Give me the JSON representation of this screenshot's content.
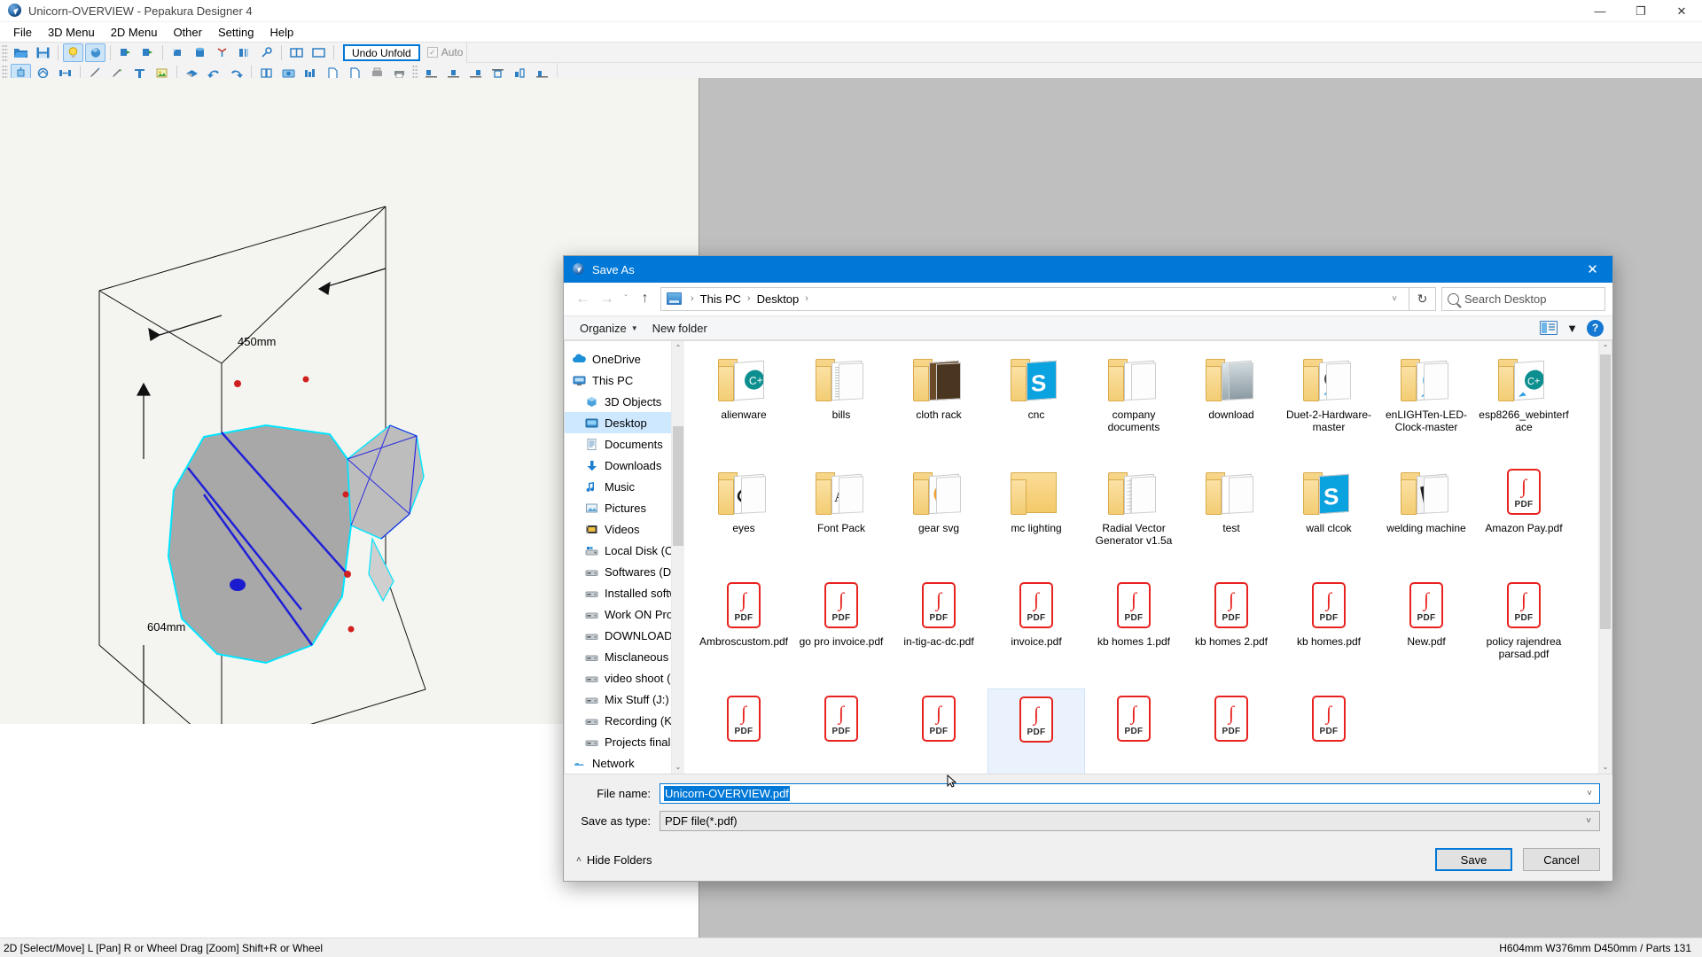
{
  "app": {
    "title": "Unicorn-OVERVIEW - Pepakura Designer 4",
    "icon": "pepakura-globe-icon",
    "window_controls": {
      "minimize": "—",
      "maximize": "❐",
      "close": "✕"
    },
    "menus": [
      "File",
      "3D Menu",
      "2D Menu",
      "Other",
      "Setting",
      "Help"
    ],
    "toolbar1": {
      "undo_label": "Undo Unfold",
      "auto_label": "Auto",
      "auto_checked": true,
      "icons": [
        "open-folder-icon",
        "save-disk-icon",
        "lightbulb-icon",
        "texture-sphere-icon",
        "unfold-arrow-icon",
        "refold-arrow-icon",
        "paint-icon",
        "cylinder-icon",
        "axis-icon",
        "mirror-icon",
        "join-icon",
        "split-view-icon",
        "single-view-icon"
      ]
    },
    "toolbar2": {
      "icons": [
        "select-move-icon",
        "shape-icon",
        "flip-icon",
        "pencil-icon",
        "green-pen-icon",
        "text-tool-icon",
        "image-tool-icon",
        "fold-icon",
        "undo-icon",
        "redo-icon",
        "open-part-icon",
        "camera-icon",
        "layout-icon",
        "page-icon",
        "page2-icon",
        "print-preview-icon",
        "print-icon",
        "align-left-icon",
        "align-center-icon",
        "align-right-icon",
        "align-top-icon",
        "align-middle-icon",
        "align-bottom-icon"
      ]
    },
    "status": {
      "left": "2D [Select/Move] L [Pan] R or Wheel Drag [Zoom] Shift+R or Wheel",
      "right": "H604mm W376mm D450mm / Parts 131"
    },
    "model": {
      "dim_height": "604mm",
      "dim_width": "376mm",
      "dim_depth": "450mm"
    }
  },
  "dialog": {
    "title": "Save As",
    "icon": "pepakura-globe-icon",
    "close": "✕",
    "nav": {
      "back": "←",
      "forward": "→",
      "recent": "ˇ",
      "up": "↑",
      "breadcrumbs": [
        "This PC",
        "Desktop"
      ],
      "breadcrumb_sep": "›",
      "dropdown": "˅",
      "refresh": "↻",
      "search_placeholder": "Search Desktop",
      "search_value": ""
    },
    "commands": {
      "organize": "Organize",
      "organize_caret": "▼",
      "new_folder": "New folder",
      "view_caret": "▼",
      "help": "?"
    },
    "tree": {
      "scroll_up": "⌃",
      "scroll_down": "⌄",
      "items": [
        {
          "label": "OneDrive",
          "icon": "onedrive-cloud-icon",
          "level": 0,
          "selected": false
        },
        {
          "label": "This PC",
          "icon": "this-pc-monitor-icon",
          "level": 0,
          "selected": false
        },
        {
          "label": "3D Objects",
          "icon": "3d-objects-cube-icon",
          "level": 1,
          "selected": false
        },
        {
          "label": "Desktop",
          "icon": "desktop-monitor-icon",
          "level": 1,
          "selected": true
        },
        {
          "label": "Documents",
          "icon": "documents-icon",
          "level": 1,
          "selected": false
        },
        {
          "label": "Downloads",
          "icon": "downloads-arrow-icon",
          "level": 1,
          "selected": false
        },
        {
          "label": "Music",
          "icon": "music-note-icon",
          "level": 1,
          "selected": false
        },
        {
          "label": "Pictures",
          "icon": "pictures-icon",
          "level": 1,
          "selected": false
        },
        {
          "label": "Videos",
          "icon": "videos-film-icon",
          "level": 1,
          "selected": false
        },
        {
          "label": "Local Disk (C:)",
          "icon": "system-disk-icon",
          "level": 1,
          "selected": false
        },
        {
          "label": "Softwares (D:)",
          "icon": "disk-drive-icon",
          "level": 1,
          "selected": false
        },
        {
          "label": "Installed softwar",
          "icon": "disk-drive-icon",
          "level": 1,
          "selected": false
        },
        {
          "label": "Work ON Progre",
          "icon": "disk-drive-icon",
          "level": 1,
          "selected": false
        },
        {
          "label": "DOWNLOADS (G",
          "icon": "disk-drive-icon",
          "level": 1,
          "selected": false
        },
        {
          "label": "Misclaneous (H:",
          "icon": "disk-drive-icon",
          "level": 1,
          "selected": false
        },
        {
          "label": "video shoot (I:)",
          "icon": "disk-drive-icon",
          "level": 1,
          "selected": false
        },
        {
          "label": "Mix Stuff (J:)",
          "icon": "disk-drive-icon",
          "level": 1,
          "selected": false
        },
        {
          "label": "Recording (K:)",
          "icon": "disk-drive-icon",
          "level": 1,
          "selected": false
        },
        {
          "label": "Projects final vid",
          "icon": "disk-drive-icon",
          "level": 1,
          "selected": false
        },
        {
          "label": "Network",
          "icon": "network-icon",
          "level": 0,
          "selected": false
        }
      ]
    },
    "files": [
      {
        "name": "alienware",
        "type": "folder",
        "selected": false
      },
      {
        "name": "bills",
        "type": "folder",
        "selected": false
      },
      {
        "name": "cloth rack",
        "type": "folder",
        "selected": false
      },
      {
        "name": "cnc",
        "type": "folder",
        "selected": false
      },
      {
        "name": "company documents",
        "type": "folder",
        "selected": false
      },
      {
        "name": "download",
        "type": "folder",
        "selected": false
      },
      {
        "name": "Duet-2-Hardware-master",
        "type": "folder",
        "selected": false
      },
      {
        "name": "enLIGHTen-LED-Clock-master",
        "type": "folder",
        "selected": false
      },
      {
        "name": "esp8266_webinterface",
        "type": "folder",
        "selected": false
      },
      {
        "name": "eyes",
        "type": "folder",
        "selected": false
      },
      {
        "name": "Font Pack",
        "type": "folder",
        "selected": false
      },
      {
        "name": "gear svg",
        "type": "folder",
        "selected": false
      },
      {
        "name": "mc lighting",
        "type": "folder-plain",
        "selected": false
      },
      {
        "name": "Radial Vector Generator v1.5a",
        "type": "folder",
        "selected": false
      },
      {
        "name": "test",
        "type": "folder",
        "selected": false
      },
      {
        "name": "wall clcok",
        "type": "folder",
        "selected": false
      },
      {
        "name": "welding machine",
        "type": "folder",
        "selected": false
      },
      {
        "name": "Amazon Pay.pdf",
        "type": "pdf",
        "selected": false
      },
      {
        "name": "Ambroscustom.pdf",
        "type": "pdf",
        "selected": false
      },
      {
        "name": "go pro invoice.pdf",
        "type": "pdf",
        "selected": false
      },
      {
        "name": "in-tig-ac-dc.pdf",
        "type": "pdf",
        "selected": false
      },
      {
        "name": "invoice.pdf",
        "type": "pdf",
        "selected": false
      },
      {
        "name": "kb homes 1.pdf",
        "type": "pdf",
        "selected": false
      },
      {
        "name": "kb homes 2.pdf",
        "type": "pdf",
        "selected": false
      },
      {
        "name": "kb homes.pdf",
        "type": "pdf",
        "selected": false
      },
      {
        "name": "New.pdf",
        "type": "pdf",
        "selected": false
      },
      {
        "name": "policy rajendrea parsad.pdf",
        "type": "pdf",
        "selected": false
      },
      {
        "name": "",
        "type": "pdf",
        "selected": false
      },
      {
        "name": "",
        "type": "pdf",
        "selected": false
      },
      {
        "name": "",
        "type": "pdf",
        "selected": false
      },
      {
        "name": "",
        "type": "pdf",
        "selected": true
      },
      {
        "name": "",
        "type": "pdf",
        "selected": false
      },
      {
        "name": "",
        "type": "pdf",
        "selected": false
      },
      {
        "name": "",
        "type": "pdf",
        "selected": false
      }
    ],
    "pdf_badge": "PDF",
    "form": {
      "filename_label": "File name:",
      "filename_value": "Unicorn-OVERVIEW.pdf",
      "filetype_label": "Save as type:",
      "filetype_value": "PDF file(*.pdf)",
      "dropdown_caret": "˅"
    },
    "footer": {
      "hide_folders": "Hide Folders",
      "hide_caret": "˄",
      "save": "Save",
      "cancel": "Cancel"
    }
  },
  "colors": {
    "accent": "#0078d7",
    "pdf_red": "#e8231f",
    "folder_yellow": "#f2c868",
    "selection_blue": "#cde8ff",
    "viewport_bg": "#f4f5f0",
    "viewport_right": "#bfbfbf"
  }
}
